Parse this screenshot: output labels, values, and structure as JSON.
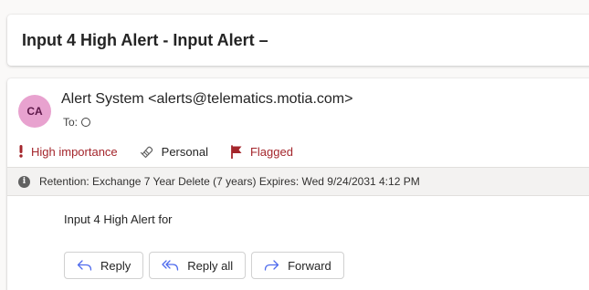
{
  "subject": "Input 4 High Alert - Input Alert –",
  "sender": {
    "initials": "CA",
    "display": "Alert System <alerts@telematics.motia.com>",
    "to_label": "To:",
    "avatar_color": "#e8a2cf"
  },
  "flags": {
    "importance": "High importance",
    "sensitivity": "Personal",
    "flagged": "Flagged",
    "alert_color": "#a4262c"
  },
  "retention": {
    "icon": "info-icon",
    "text": "Retention: Exchange 7 Year Delete (7 years) Expires: Wed 9/24/2031 4:12 PM"
  },
  "body": {
    "text": "Input 4 High Alert for"
  },
  "actions": {
    "reply": "Reply",
    "reply_all": "Reply all",
    "forward": "Forward",
    "icon_color": "#4f6bed"
  }
}
